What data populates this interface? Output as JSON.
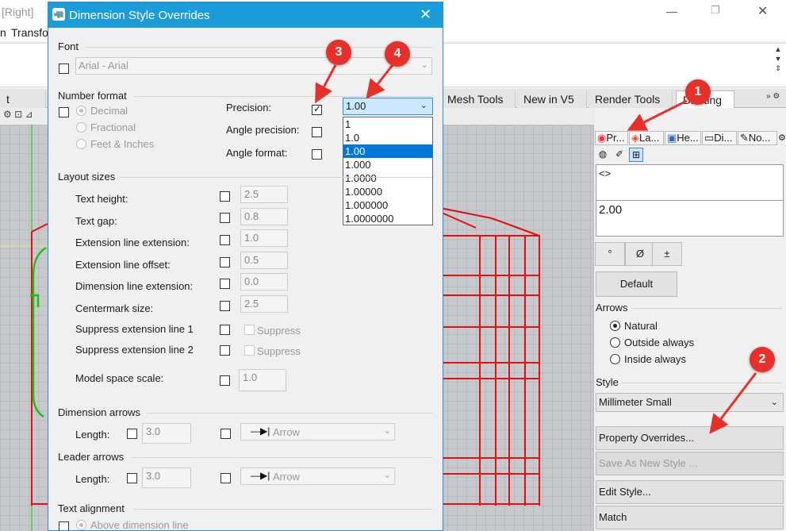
{
  "app": {
    "title": "[Right]",
    "minimize": "—",
    "restore": "❐",
    "close": "✕",
    "menu": [
      "n",
      "Transfo"
    ],
    "tabs": [
      "t Layout",
      "Mesh Tools",
      "New in V5",
      "Render Tools",
      "Drafting"
    ],
    "tab_scroll": "»",
    "tab_gear": "⚙"
  },
  "panel": {
    "tabs": [
      "Pr...",
      "La...",
      "He...",
      "Di...",
      "No..."
    ],
    "text_value": "<>",
    "display_value": "2.00",
    "symbol_buttons": [
      "°",
      "Ø",
      "±"
    ],
    "default_button": "Default",
    "arrows_label": "Arrows",
    "arrow_options": [
      {
        "label": "Natural",
        "selected": true
      },
      {
        "label": "Outside always",
        "selected": false
      },
      {
        "label": "Inside always",
        "selected": false
      }
    ],
    "style_label": "Style",
    "style_value": "Millimeter Small",
    "property_overrides_button": "Property Overrides...",
    "save_as_new_style_button": "Save As New Style ...",
    "edit_style_button": "Edit Style...",
    "match_button": "Match"
  },
  "dialog": {
    "title": "Dimension Style Overrides",
    "close": "✕",
    "font_group": "Font",
    "font_value": "Arial - Arial",
    "number_format_group": "Number format",
    "number_formats": [
      {
        "label": "Decimal",
        "selected": true
      },
      {
        "label": "Fractional",
        "selected": false
      },
      {
        "label": "Feet & Inches",
        "selected": false
      }
    ],
    "precision_label": "Precision:",
    "precision_checked": true,
    "precision_value": "1.00",
    "precision_options": [
      "1",
      "1.0",
      "1.00",
      "1.000",
      "1.0000",
      "1.00000",
      "1.000000",
      "1.0000000"
    ],
    "precision_selected_index": 2,
    "angle_precision_label": "Angle precision:",
    "angle_format_label": "Angle format:",
    "layout_sizes_group": "Layout sizes",
    "layout_rows": [
      {
        "label": "Text height:",
        "value": "2.5"
      },
      {
        "label": "Text gap:",
        "value": "0.8"
      },
      {
        "label": "Extension line extension:",
        "value": "1.0"
      },
      {
        "label": "Extension line offset:",
        "value": "0.5"
      },
      {
        "label": "Dimension line extension:",
        "value": "0.0"
      },
      {
        "label": "Centermark size:",
        "value": "2.5"
      }
    ],
    "suppress_rows": [
      {
        "label": "Suppress extension line 1",
        "option": "Suppress"
      },
      {
        "label": "Suppress extension line 2",
        "option": "Suppress"
      }
    ],
    "model_space_scale_label": "Model space scale:",
    "model_space_scale_value": "1.0",
    "dimension_arrows_group": "Dimension arrows",
    "dimension_arrow_length_label": "Length:",
    "dimension_arrow_length_value": "3.0",
    "dimension_arrow_type": "Arrow",
    "leader_arrows_group": "Leader arrows",
    "leader_arrow_length_label": "Length:",
    "leader_arrow_length_value": "3.0",
    "leader_arrow_type": "Arrow",
    "text_alignment_group": "Text alignment",
    "text_alignment_option": "Above dimension line"
  },
  "annotations": [
    "1",
    "2",
    "3",
    "4"
  ],
  "colors": {
    "dialog_title_bg": "#1c9dd9",
    "annotation_red": "#e8302a",
    "drawing_red": "#e01010",
    "drawing_green": "#19c219",
    "selection_blue": "#0078d7"
  }
}
